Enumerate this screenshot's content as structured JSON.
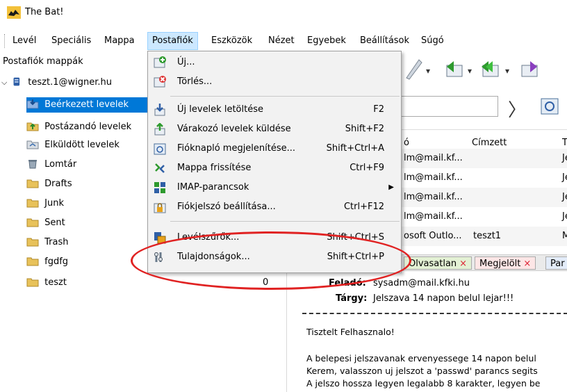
{
  "window": {
    "title": "The Bat!"
  },
  "menubar": {
    "items": [
      {
        "label": "Levél"
      },
      {
        "label": "Speciális"
      },
      {
        "label": "Mappa"
      },
      {
        "label": "Postafiók"
      },
      {
        "label": "Eszközök"
      },
      {
        "label": "Nézet"
      },
      {
        "label": "Egyebek"
      },
      {
        "label": "Beállítások"
      },
      {
        "label": "Súgó"
      }
    ]
  },
  "folders": {
    "header": "Postafiók mappák",
    "account": "teszt.1@wigner.hu",
    "items": [
      {
        "label": "Beérkezett levelek",
        "icon": "inbox-folder-icon"
      },
      {
        "label": "Postázandó levelek",
        "icon": "outbox-folder-icon"
      },
      {
        "label": "Elküldött levelek",
        "icon": "sent-items-folder-icon"
      },
      {
        "label": "Lomtár",
        "icon": "trash-bin-icon"
      },
      {
        "label": "Drafts",
        "icon": "folder-icon"
      },
      {
        "label": "Junk",
        "icon": "folder-icon"
      },
      {
        "label": "Sent",
        "icon": "folder-icon"
      },
      {
        "label": "Trash",
        "icon": "folder-icon"
      },
      {
        "label": "fgdfg",
        "icon": "folder-icon"
      },
      {
        "label": "teszt",
        "icon": "folder-icon",
        "count": "0"
      }
    ]
  },
  "message_list": {
    "columns": [
      "ó",
      "Címzett",
      "T"
    ],
    "rows": [
      {
        "from": "lm@mail.kf...",
        "to": "",
        "subject": "Je"
      },
      {
        "from": "lm@mail.kf...",
        "to": "",
        "subject": "Je"
      },
      {
        "from": "lm@mail.kf...",
        "to": "",
        "subject": "Je"
      },
      {
        "from": "lm@mail.kf...",
        "to": "",
        "subject": "Je"
      },
      {
        "from": "osoft Outlo...",
        "to": "teszt1",
        "subject": "M"
      }
    ]
  },
  "filter_tabs": [
    {
      "label": "Olvasatlan",
      "close": "×"
    },
    {
      "label": "Megjelölt",
      "close": "×"
    },
    {
      "label": "Par"
    }
  ],
  "preview": {
    "from_label": "Feladó:",
    "from_value": "sysadm@mail.kfki.hu",
    "subject_label": "Tárgy:",
    "subject_value": "Jelszava 14 napon belul lejar!!!",
    "body_lines": [
      "Tisztelt Felhasznalo!",
      "",
      "A belepesi jelszavanak ervenyessege 14 napon belul",
      "Kerem, valasszon uj jelszot a 'passwd' parancs segits",
      "A jelszo hossza legyen legalabb 8 karakter, legyen be"
    ]
  },
  "postafiok_menu": {
    "items": [
      {
        "label": "Új...",
        "shortcut": "",
        "icon": "new-account-icon"
      },
      {
        "label": "Törlés...",
        "shortcut": "",
        "icon": "delete-account-icon"
      },
      {
        "label": "Új levelek letöltése",
        "shortcut": "F2",
        "icon": "get-mail-icon"
      },
      {
        "label": "Várakozó levelek küldése",
        "shortcut": "Shift+F2",
        "icon": "send-queued-icon"
      },
      {
        "label": "Fióknapló megjelenítése...",
        "shortcut": "Shift+Ctrl+A",
        "icon": "account-log-icon"
      },
      {
        "label": "Mappa frissítése",
        "shortcut": "Ctrl+F9",
        "icon": "refresh-folder-icon"
      },
      {
        "label": "IMAP-parancsok",
        "shortcut": "",
        "icon": "imap-commands-icon",
        "submenu": "▶"
      },
      {
        "label": "Fiókjelszó beállítása...",
        "shortcut": "Ctrl+F12",
        "icon": "account-password-icon"
      },
      {
        "label": "Levélszűrők...",
        "shortcut": "Shift+Ctrl+S",
        "icon": "mail-filters-icon"
      },
      {
        "label": "Tulajdonságok...",
        "shortcut": "Shift+Ctrl+P",
        "icon": "properties-icon"
      }
    ]
  },
  "colors": {
    "menu_highlight": "#cce8ff",
    "selection": "#0078d7",
    "annotation": "#e02222",
    "folder_yellow": "#e8c25a"
  }
}
